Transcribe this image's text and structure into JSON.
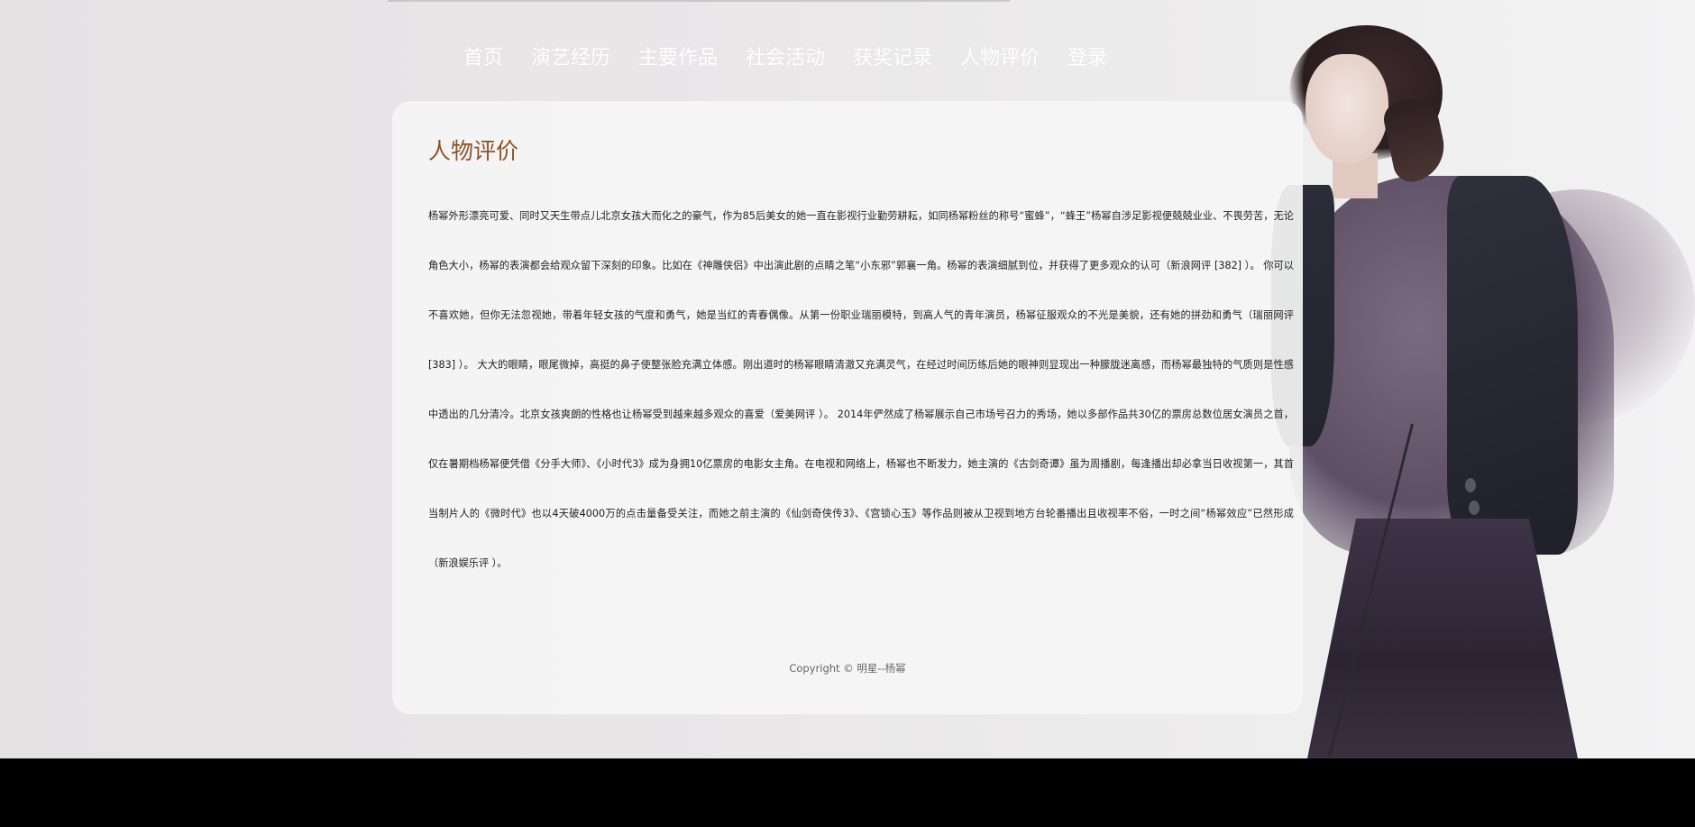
{
  "nav": {
    "items": [
      {
        "label": "首页"
      },
      {
        "label": "演艺经历"
      },
      {
        "label": "主要作品"
      },
      {
        "label": "社会活动"
      },
      {
        "label": "获奖记录"
      },
      {
        "label": "人物评价"
      },
      {
        "label": "登录"
      }
    ]
  },
  "main": {
    "title": "人物评价",
    "body": "杨幂外形漂亮可爱、同时又天生带点儿北京女孩大而化之的豪气，作为85后美女的她一直在影视行业勤劳耕耘，如同杨幂粉丝的称号“蜜蜂”，“蜂王”杨幂自涉足影视便兢兢业业、不畏劳苦，无论角色大小，杨幂的表演都会给观众留下深刻的印象。比如在《神雕侠侣》中出演此剧的点睛之笔“小东邪”郭襄一角。杨幂的表演细腻到位，并获得了更多观众的认可（新浪网评 [382] ）。 你可以不喜欢她，但你无法忽视她，带着年轻女孩的气度和勇气，她是当红的青春偶像。从第一份职业瑞丽模特，到高人气的青年演员，杨幂征服观众的不光是美貌，还有她的拼劲和勇气（瑞丽网评 [383] ）。 大大的眼睛，眼尾微掉，高挺的鼻子使整张脸充满立体感。刚出道时的杨幂眼睛清澈又充满灵气，在经过时间历练后她的眼神则显现出一种朦胧迷离感，而杨幂最独特的气质则是性感中透出的几分清冷。北京女孩爽朗的性格也让杨幂受到越来越多观众的喜爱（爱美网评 ）。 2014年俨然成了杨幂展示自己市场号召力的秀场，她以多部作品共30亿的票房总数位居女演员之首，仅在暑期档杨幂便凭借《分手大师》、《小时代3》成为身拥10亿票房的电影女主角。在电视和网络上，杨幂也不断发力，她主演的《古剑奇谭》虽为周播剧，每逢播出却必拿当日收视第一，其首当制片人的《微时代》也以4天破4000万的点击量备受关注，而她之前主演的《仙剑奇侠传3》、《宫锁心玉》等作品则被从卫视到地方台轮番播出且收视率不俗，一时之间“杨幂效应”已然形成（新浪娱乐评 ）。"
  },
  "footer": {
    "copyright": "Copyright © 明星--杨幂"
  },
  "colors": {
    "title": "#8a5427",
    "nav_text": "#ffffff",
    "card_bg": "#f5f5f5",
    "bottom_bar": "#000000"
  }
}
